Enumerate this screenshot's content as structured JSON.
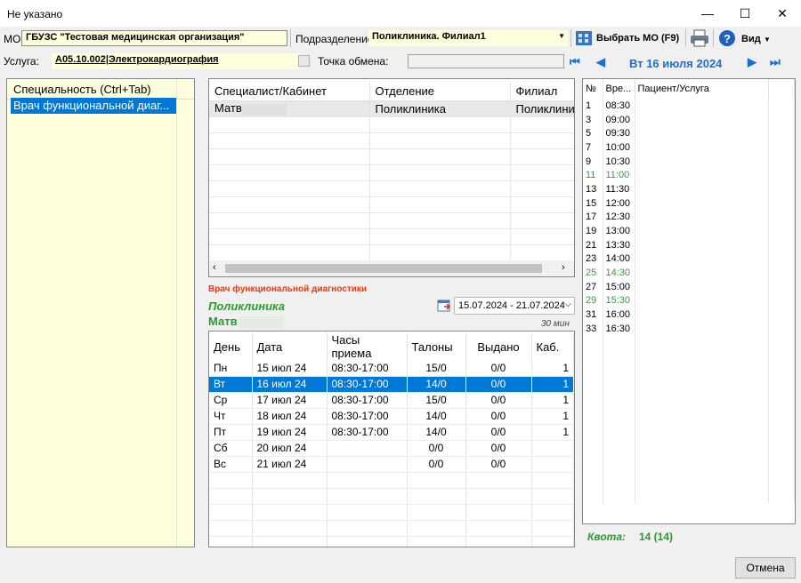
{
  "window": {
    "title": "Не указано",
    "minimize": "—",
    "maximize": "☐",
    "close": "✕"
  },
  "toolbar": {
    "mo_label": "МО",
    "mo_value": "ГБУЗС \"Тестовая медицинская организация\"",
    "division_label": "Подразделение",
    "division_value": "Поликлиника. Филиал1",
    "select_mo": "Выбрать МО (F9)",
    "view": "Вид",
    "service_label": "Услуга:",
    "service_value": "А05.10.002|Электрокардиография",
    "exchange_label": "Точка обмена:",
    "exchange_value": ""
  },
  "nav": {
    "date": "Вт 16 июля 2024"
  },
  "specialty": {
    "header": "Специальность (Ctrl+Tab)",
    "items": [
      "Врач функциональной диаг..."
    ]
  },
  "specialists": {
    "columns": [
      "Специалист/Кабинет",
      "Отделение",
      "Филиал"
    ],
    "rows": [
      [
        "Матв",
        "Поликлиника",
        "Поликлини"
      ]
    ]
  },
  "doctor": {
    "specialty": "Врач функциональной диагностики",
    "department": "Поликлиника",
    "name": "Матв",
    "duration": "30 мин",
    "date_range": "15.07.2024 - 21.07.2024"
  },
  "schedule": {
    "columns": [
      "День",
      "Дата",
      "Часы приема",
      "Талоны",
      "Выдано",
      "Каб."
    ],
    "rows": [
      [
        "Пн",
        "15 июл 24",
        "08:30-17:00",
        "15/0",
        "0/0",
        "1"
      ],
      [
        "Вт",
        "16 июл 24",
        "08:30-17:00",
        "14/0",
        "0/0",
        "1"
      ],
      [
        "Ср",
        "17 июл 24",
        "08:30-17:00",
        "15/0",
        "0/0",
        "1"
      ],
      [
        "Чт",
        "18 июл 24",
        "08:30-17:00",
        "14/0",
        "0/0",
        "1"
      ],
      [
        "Пт",
        "19 июл 24",
        "08:30-17:00",
        "14/0",
        "0/0",
        "1"
      ],
      [
        "Сб",
        "20 июл 24",
        "",
        "0/0",
        "0/0",
        ""
      ],
      [
        "Вс",
        "21 июл 24",
        "",
        "0/0",
        "0/0",
        ""
      ]
    ],
    "selected_index": 1
  },
  "slots": {
    "columns": [
      "№",
      "Вре...",
      "Пациент/Услуга"
    ],
    "rows": [
      [
        "1",
        "08:30"
      ],
      [
        "3",
        "09:00"
      ],
      [
        "5",
        "09:30"
      ],
      [
        "7",
        "10:00"
      ],
      [
        "9",
        "10:30"
      ],
      [
        "11",
        "11:00"
      ],
      [
        "13",
        "11:30"
      ],
      [
        "15",
        "12:00"
      ],
      [
        "17",
        "12:30"
      ],
      [
        "19",
        "13:00"
      ],
      [
        "21",
        "13:30"
      ],
      [
        "23",
        "14:00"
      ],
      [
        "25",
        "14:30"
      ],
      [
        "27",
        "15:00"
      ],
      [
        "29",
        "15:30"
      ],
      [
        "31",
        "16:00"
      ],
      [
        "33",
        "16:30"
      ]
    ],
    "green_rows": [
      5,
      12,
      14
    ]
  },
  "quota": {
    "label": "Квота:",
    "value": "14 (14)"
  },
  "footer": {
    "cancel": "Отмена"
  },
  "colors": {
    "accent": "#0078d7",
    "field_bg": "#fffedd",
    "green": "#2e9a2e",
    "red": "#ff3300"
  }
}
